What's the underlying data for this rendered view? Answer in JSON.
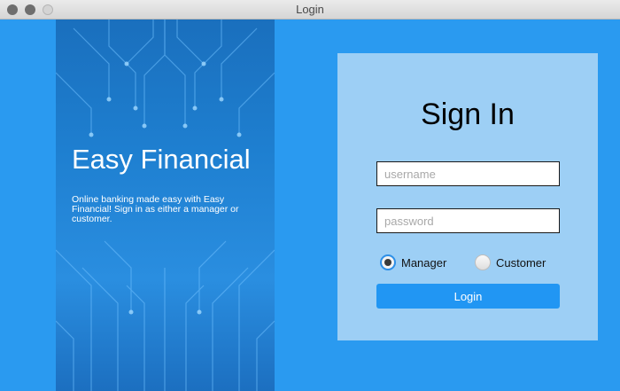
{
  "window": {
    "title": "Login"
  },
  "hero": {
    "title": "Easy Financial",
    "description": "Online banking made easy with Easy Financial! Sign in as either a manager or customer."
  },
  "form": {
    "heading": "Sign In",
    "username_placeholder": "username",
    "password_placeholder": "password",
    "roles": [
      {
        "label": "Manager",
        "selected": true
      },
      {
        "label": "Customer",
        "selected": false
      }
    ],
    "submit_label": "Login"
  },
  "colors": {
    "background": "#2a9af0",
    "card": "#9dcff5",
    "button": "#2196f3",
    "radio_accent": "#2d8fe8"
  },
  "icons": [
    "close-icon",
    "minimize-icon",
    "zoom-icon",
    "circuit-board-graphic"
  ]
}
